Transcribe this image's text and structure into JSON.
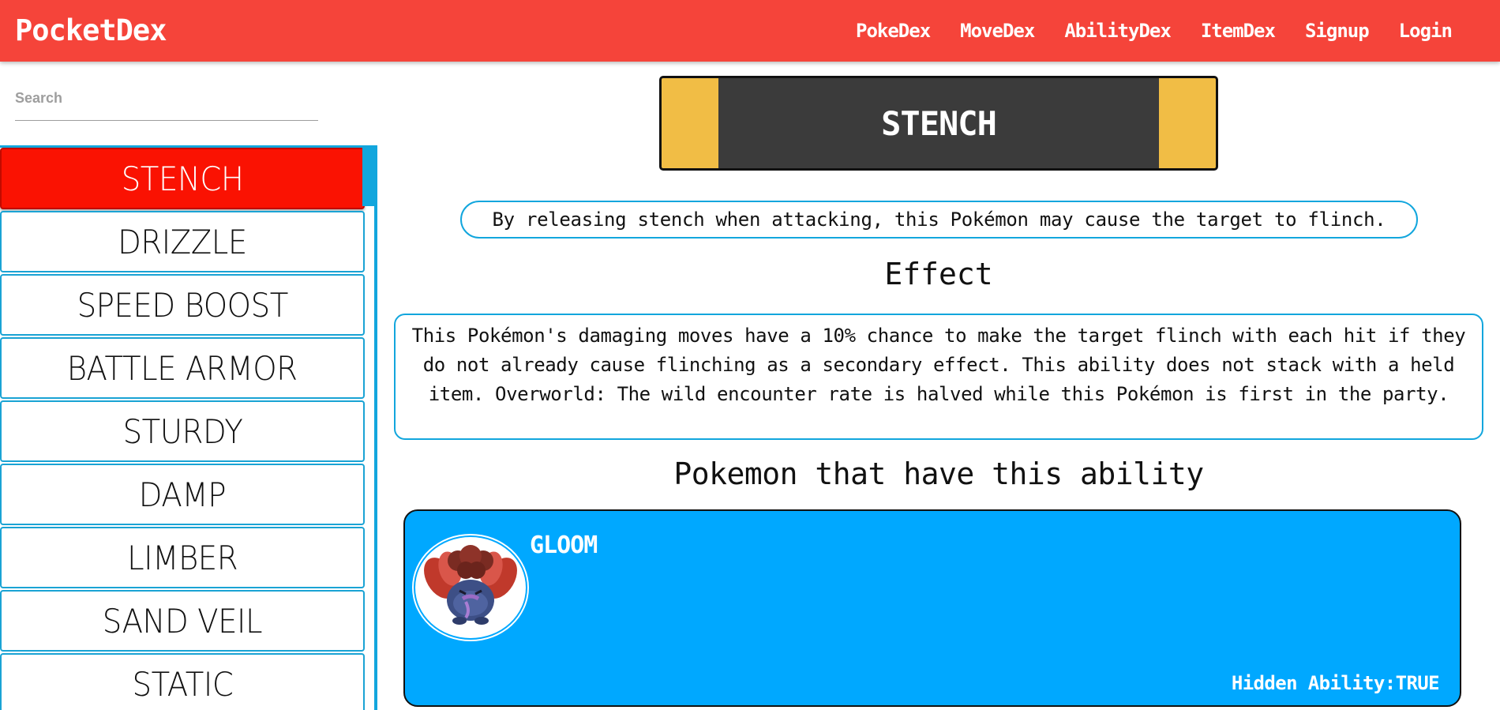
{
  "app": {
    "brand": "PocketDex"
  },
  "nav": {
    "items": [
      {
        "label": "PokeDex"
      },
      {
        "label": "MoveDex"
      },
      {
        "label": "AbilityDex"
      },
      {
        "label": "ItemDex"
      },
      {
        "label": "Signup"
      },
      {
        "label": "Login"
      }
    ]
  },
  "sidebar": {
    "search": {
      "placeholder": "Search",
      "value": ""
    },
    "abilities": [
      {
        "label": "STENCH",
        "active": true
      },
      {
        "label": "DRIZZLE",
        "active": false
      },
      {
        "label": "SPEED BOOST",
        "active": false
      },
      {
        "label": "BATTLE ARMOR",
        "active": false
      },
      {
        "label": "STURDY",
        "active": false
      },
      {
        "label": "DAMP",
        "active": false
      },
      {
        "label": "LIMBER",
        "active": false
      },
      {
        "label": "SAND VEIL",
        "active": false
      },
      {
        "label": "STATIC",
        "active": false
      }
    ]
  },
  "ability": {
    "name": "STENCH",
    "short_description": "By releasing stench when attacking, this Pokémon may cause the target to flinch.",
    "effect_heading": "Effect",
    "effect": "This Pokémon's damaging moves have a 10% chance to make the target flinch with each hit if they do not already cause flinching as a secondary effect. This ability does not stack with a held item. Overworld: The wild encounter rate is halved while this Pokémon is first in the party.",
    "pokemon_heading": "Pokemon that have this ability",
    "pokemon": [
      {
        "name": "GLOOM",
        "hidden_ability_text": "Hidden Ability:TRUE"
      }
    ]
  },
  "colors": {
    "navbar": "#f5443a",
    "accent_blue": "#12a6dd",
    "card_blue": "#00a8ff",
    "active_item": "#fa1202",
    "banner_gold": "#f1bd45",
    "banner_dark": "#3b3b3b"
  },
  "icons": {
    "pokemon_avatar": "gloom-sprite-icon"
  }
}
